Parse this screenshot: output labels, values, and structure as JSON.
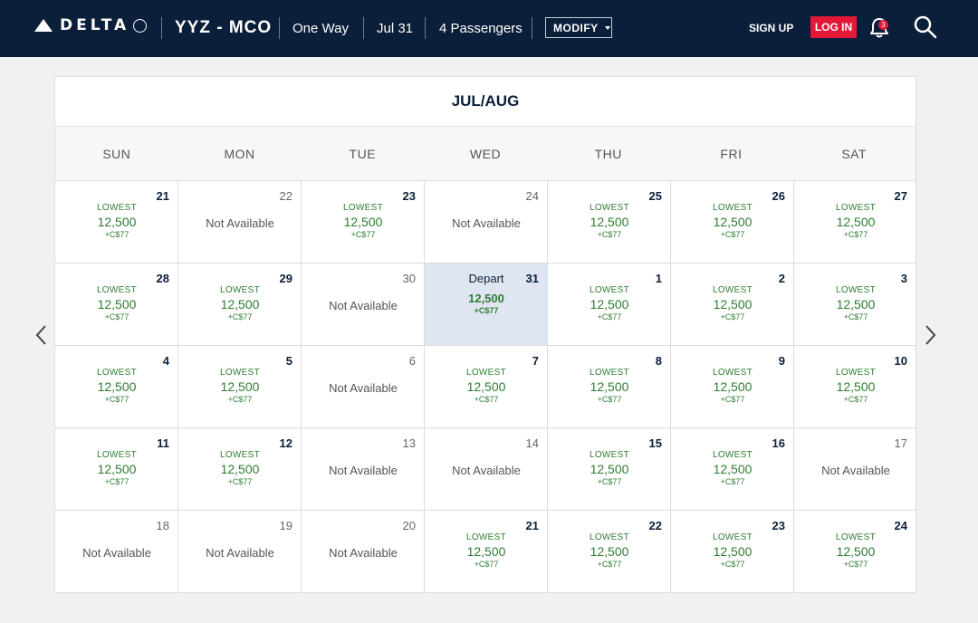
{
  "header": {
    "brand": "DELTA",
    "route": "YYZ - MCO",
    "trip_type": "One Way",
    "date": "Jul 31",
    "passengers": "4 Passengers",
    "modify_label": "MODIFY",
    "signup_label": "SIGN UP",
    "login_label": "LOG IN",
    "notification_count": "3"
  },
  "calendar": {
    "month_title": "JUL/AUG",
    "weekdays": [
      "SUN",
      "MON",
      "TUE",
      "WED",
      "THU",
      "FRI",
      "SAT"
    ],
    "weeks": [
      [
        {
          "day": "21",
          "available": true,
          "lowest": "LOWEST",
          "price": "12,500",
          "tax": "+C$77"
        },
        {
          "day": "22",
          "available": false,
          "text": "Not Available"
        },
        {
          "day": "23",
          "available": true,
          "lowest": "LOWEST",
          "price": "12,500",
          "tax": "+C$77"
        },
        {
          "day": "24",
          "available": false,
          "text": "Not Available"
        },
        {
          "day": "25",
          "available": true,
          "lowest": "LOWEST",
          "price": "12,500",
          "tax": "+C$77"
        },
        {
          "day": "26",
          "available": true,
          "lowest": "LOWEST",
          "price": "12,500",
          "tax": "+C$77"
        },
        {
          "day": "27",
          "available": true,
          "lowest": "LOWEST",
          "price": "12,500",
          "tax": "+C$77"
        }
      ],
      [
        {
          "day": "28",
          "available": true,
          "lowest": "LOWEST",
          "price": "12,500",
          "tax": "+C$77"
        },
        {
          "day": "29",
          "available": true,
          "lowest": "LOWEST",
          "price": "12,500",
          "tax": "+C$77"
        },
        {
          "day": "30",
          "available": false,
          "text": "Not Available"
        },
        {
          "day": "31",
          "available": true,
          "selected": true,
          "depart": "Depart",
          "price": "12,500",
          "tax": "+C$77"
        },
        {
          "day": "1",
          "available": true,
          "lowest": "LOWEST",
          "price": "12,500",
          "tax": "+C$77"
        },
        {
          "day": "2",
          "available": true,
          "lowest": "LOWEST",
          "price": "12,500",
          "tax": "+C$77"
        },
        {
          "day": "3",
          "available": true,
          "lowest": "LOWEST",
          "price": "12,500",
          "tax": "+C$77"
        }
      ],
      [
        {
          "day": "4",
          "available": true,
          "lowest": "LOWEST",
          "price": "12,500",
          "tax": "+C$77"
        },
        {
          "day": "5",
          "available": true,
          "lowest": "LOWEST",
          "price": "12,500",
          "tax": "+C$77"
        },
        {
          "day": "6",
          "available": false,
          "text": "Not Available"
        },
        {
          "day": "7",
          "available": true,
          "lowest": "LOWEST",
          "price": "12,500",
          "tax": "+C$77"
        },
        {
          "day": "8",
          "available": true,
          "lowest": "LOWEST",
          "price": "12,500",
          "tax": "+C$77"
        },
        {
          "day": "9",
          "available": true,
          "lowest": "LOWEST",
          "price": "12,500",
          "tax": "+C$77"
        },
        {
          "day": "10",
          "available": true,
          "lowest": "LOWEST",
          "price": "12,500",
          "tax": "+C$77"
        }
      ],
      [
        {
          "day": "11",
          "available": true,
          "lowest": "LOWEST",
          "price": "12,500",
          "tax": "+C$77"
        },
        {
          "day": "12",
          "available": true,
          "lowest": "LOWEST",
          "price": "12,500",
          "tax": "+C$77"
        },
        {
          "day": "13",
          "available": false,
          "text": "Not Available"
        },
        {
          "day": "14",
          "available": false,
          "text": "Not Available"
        },
        {
          "day": "15",
          "available": true,
          "lowest": "LOWEST",
          "price": "12,500",
          "tax": "+C$77"
        },
        {
          "day": "16",
          "available": true,
          "lowest": "LOWEST",
          "price": "12,500",
          "tax": "+C$77"
        },
        {
          "day": "17",
          "available": false,
          "text": "Not Available"
        }
      ],
      [
        {
          "day": "18",
          "available": false,
          "text": "Not Available"
        },
        {
          "day": "19",
          "available": false,
          "text": "Not Available"
        },
        {
          "day": "20",
          "available": false,
          "text": "Not Available"
        },
        {
          "day": "21",
          "available": true,
          "lowest": "LOWEST",
          "price": "12,500",
          "tax": "+C$77"
        },
        {
          "day": "22",
          "available": true,
          "lowest": "LOWEST",
          "price": "12,500",
          "tax": "+C$77"
        },
        {
          "day": "23",
          "available": true,
          "lowest": "LOWEST",
          "price": "12,500",
          "tax": "+C$77"
        },
        {
          "day": "24",
          "available": true,
          "lowest": "LOWEST",
          "price": "12,500",
          "tax": "+C$77"
        }
      ]
    ]
  },
  "colors": {
    "header_bg": "#0b1f3a",
    "login_red": "#e31837",
    "price_green": "#2e7d32",
    "selected_bg": "#dfe6f1"
  }
}
